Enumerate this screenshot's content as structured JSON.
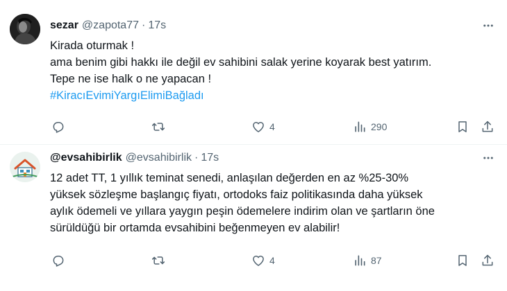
{
  "tweets": [
    {
      "display_name": "sezar",
      "handle": "@zapota77",
      "separator": "·",
      "time": "17s",
      "more_icon": "more-horizontal-icon",
      "lines": [
        "Kirada oturmak !",
        "ama benim gibi hakkı ile değil ev sahibini salak yerine koyarak best yatırım.",
        "Tepe ne ise halk o ne yapacan !"
      ],
      "hashtag": "#KiracıEvimiYargıElimiBağladı",
      "actions": {
        "reply_count": "",
        "retweet_count": "",
        "like_count": "4",
        "views_count": "290"
      }
    },
    {
      "display_name": "@evsahibirlik",
      "handle": "@evsahibirlik",
      "separator": "·",
      "time": "17s",
      "more_icon": "more-horizontal-icon",
      "lines": [
        "12 adet TT, 1 yıllık teminat senedi, anlaşılan değerden en az %25-30%",
        "yüksek sözleşme başlangıç fiyatı,  ortodoks faiz politikasında daha yüksek",
        "aylık ödemeli ve yıllara yaygın peşin ödemelere indirim olan ve şartların öne",
        "sürüldüğü bir ortamda evsahibini beğenmeyen ev alabilir!"
      ],
      "actions": {
        "reply_count": "",
        "retweet_count": "",
        "like_count": "4",
        "views_count": "87"
      }
    }
  ],
  "colors": {
    "text": "#0f1419",
    "secondary": "#536471",
    "link": "#1d9bf0",
    "divider": "#eff3f4"
  },
  "icons": [
    "reply-icon",
    "retweet-icon",
    "like-icon",
    "views-icon",
    "bookmark-icon",
    "share-icon"
  ]
}
